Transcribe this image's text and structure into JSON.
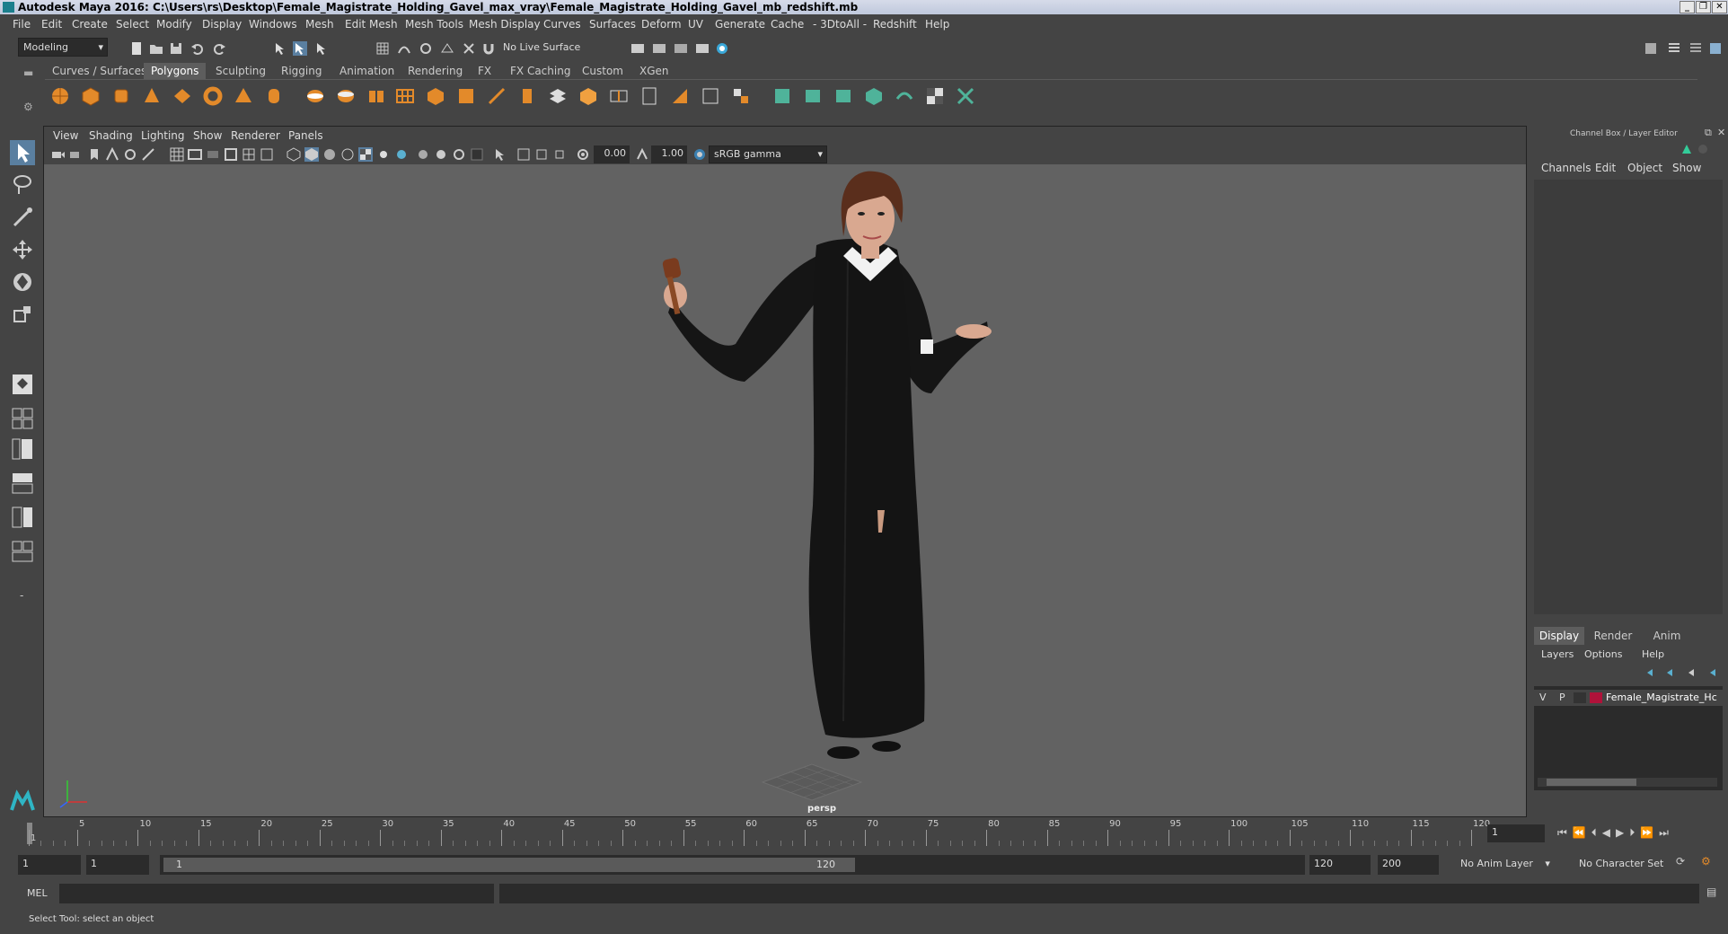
{
  "window": {
    "title": "Autodesk Maya 2016: C:\\Users\\rs\\Desktop\\Female_Magistrate_Holding_Gavel_max_vray\\Female_Magistrate_Holding_Gavel_mb_redshift.mb",
    "controls": [
      "minimize-icon",
      "restore-icon",
      "close-icon"
    ]
  },
  "menubar": {
    "items": [
      "File",
      "Edit",
      "Create",
      "Select",
      "Modify",
      "Display",
      "Windows",
      "Mesh",
      "Edit Mesh",
      "Mesh Tools",
      "Mesh Display",
      "Curves",
      "Surfaces",
      "Deform",
      "UV",
      "Generate",
      "Cache",
      "- 3DtoAll -",
      "Redshift",
      "Help"
    ]
  },
  "statusline": {
    "mode": "Modeling",
    "live_surface": "No Live Surface"
  },
  "shelf": {
    "tabs": [
      "Curves / Surfaces",
      "Polygons",
      "Sculpting",
      "Rigging",
      "Animation",
      "Rendering",
      "FX",
      "FX Caching",
      "Custom",
      "XGen"
    ],
    "active_tab": "Polygons",
    "icon_colors": {
      "primitive": "#e38a2a",
      "edit": "#4fb39a"
    }
  },
  "viewport": {
    "menus": [
      "View",
      "Shading",
      "Lighting",
      "Show",
      "Renderer",
      "Panels"
    ],
    "exposure": "0.00",
    "gamma": "1.00",
    "color_space": "sRGB gamma",
    "camera_label": "persp"
  },
  "channelbox": {
    "title": "Channel Box / Layer Editor",
    "menus": [
      "Channels",
      "Edit",
      "Object",
      "Show"
    ],
    "layer_tabs": [
      "Display",
      "Render",
      "Anim"
    ],
    "active_layer_tab": "Display",
    "layer_menus": [
      "Layers",
      "Options",
      "Help"
    ],
    "layer": {
      "visible": "V",
      "playback": "P",
      "name": "Female_Magistrate_Hc",
      "color": "#b0123a"
    }
  },
  "timeline": {
    "ticks": [
      "1",
      "5",
      "10",
      "15",
      "20",
      "25",
      "30",
      "35",
      "40",
      "45",
      "50",
      "55",
      "60",
      "65",
      "70",
      "75",
      "80",
      "85",
      "90",
      "95",
      "100",
      "105",
      "110",
      "115",
      "120"
    ],
    "current_frame": "1"
  },
  "range": {
    "start": "1",
    "playback_start": "1",
    "slider_start": "1",
    "slider_end": "120",
    "playback_end": "120",
    "end": "200",
    "anim_layer": "No Anim Layer",
    "character_set": "No Character Set"
  },
  "cmdline": {
    "label": "MEL"
  },
  "helpline": {
    "text": "Select Tool: select an object"
  }
}
